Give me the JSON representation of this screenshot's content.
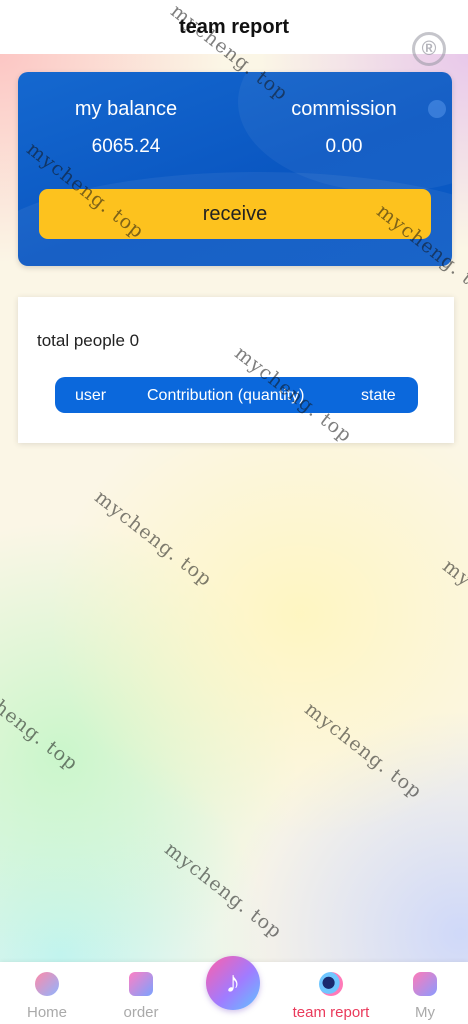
{
  "header": {
    "title": "team report",
    "registered_mark": "®"
  },
  "balance_card": {
    "balance_label": "my balance",
    "balance_value": "6065.24",
    "commission_label": "commission",
    "commission_value": "0.00",
    "receive_label": "receive"
  },
  "team": {
    "total_people": "total people 0",
    "columns": {
      "user": "user",
      "contribution": "Contribution (quantity)",
      "state": "state"
    }
  },
  "watermark": "mycheng. top",
  "tabbar": {
    "items": [
      {
        "label": "Home",
        "icon": "home-icon"
      },
      {
        "label": "order",
        "icon": "order-icon"
      },
      {
        "label": "",
        "icon": "music-note-icon"
      },
      {
        "label": "team report",
        "icon": "team-icon",
        "active": true
      },
      {
        "label": "My",
        "icon": "my-icon"
      }
    ]
  },
  "colors": {
    "card_blue": "#0a57c2",
    "button_yellow": "#fdc21e",
    "active_tab": "#ea3a5b"
  }
}
